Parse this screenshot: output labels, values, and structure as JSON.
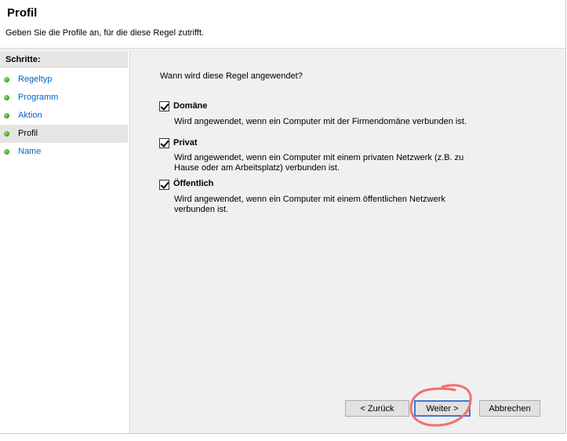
{
  "header": {
    "title": "Profil",
    "description": "Geben Sie die Profile an, für die diese Regel zutrifft."
  },
  "sidebar": {
    "heading": "Schritte:",
    "steps": [
      {
        "label": "Regeltyp"
      },
      {
        "label": "Programm"
      },
      {
        "label": "Aktion"
      },
      {
        "label": "Profil",
        "active": true
      },
      {
        "label": "Name"
      }
    ]
  },
  "main": {
    "question": "Wann wird diese Regel angewendet?",
    "options": [
      {
        "title": "Domäne",
        "checked": true,
        "description": "Wird angewendet, wenn ein Computer mit der Firmendomäne verbunden ist."
      },
      {
        "title": "Privat",
        "checked": true,
        "description": "Wird angewendet, wenn ein Computer mit einem privaten Netzwerk (z.B. zu Hause oder am Arbeitsplatz) verbunden ist."
      },
      {
        "title": "Öffentlich",
        "checked": true,
        "description": "Wird angewendet, wenn ein Computer mit einem öffentlichen Netzwerk verbunden ist."
      }
    ]
  },
  "buttons": {
    "back": "< Zurück",
    "next": "Weiter >",
    "cancel": "Abbrechen"
  },
  "colors": {
    "annotation": "#f07070",
    "link": "#0066cc"
  }
}
